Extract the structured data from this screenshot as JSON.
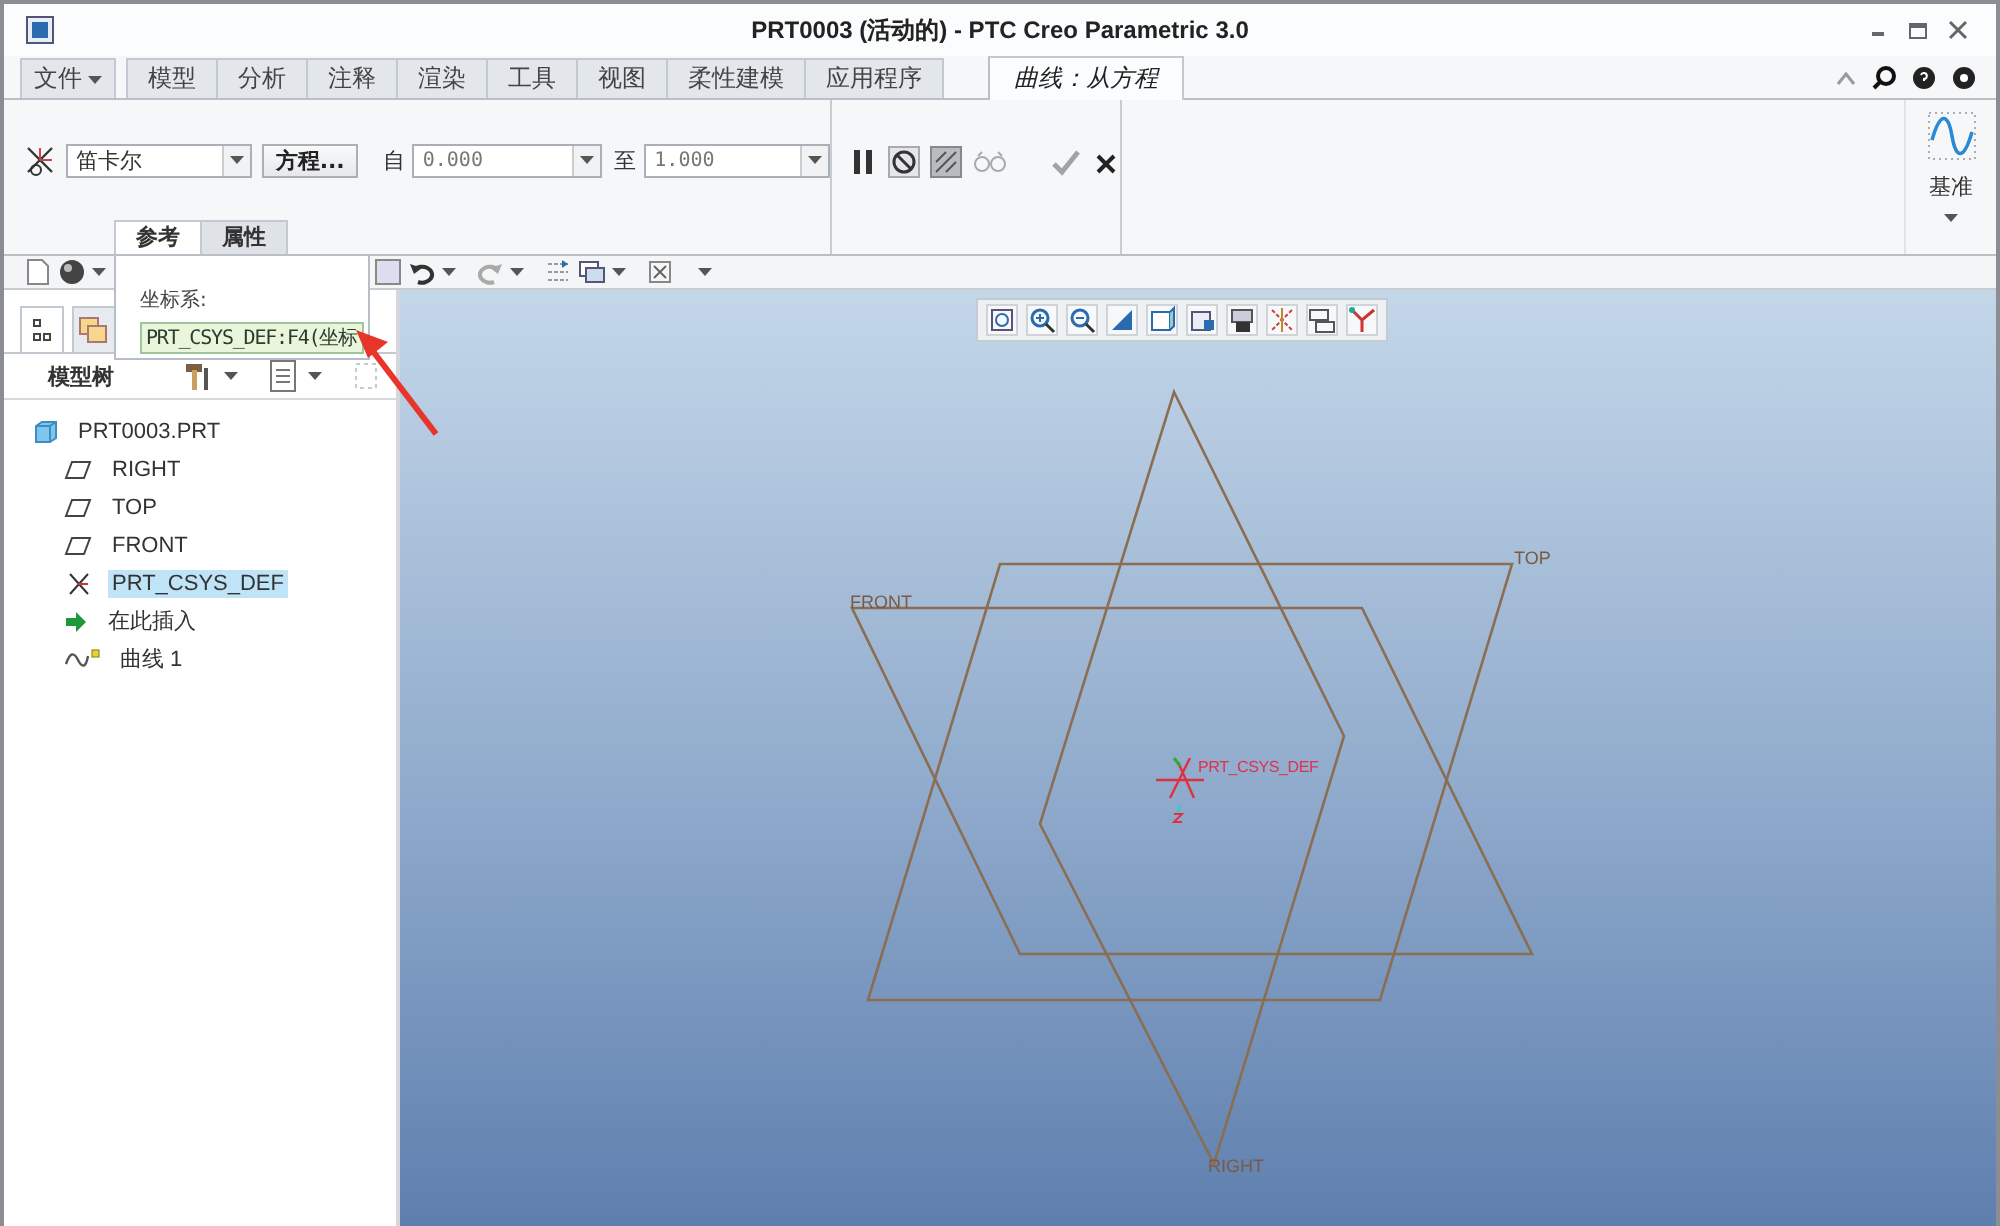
{
  "window": {
    "title": "PRT0003 (活动的) - PTC Creo Parametric 3.0"
  },
  "ribbon_tabs": [
    {
      "label": "文件",
      "kind": "menu",
      "selected": false
    },
    {
      "label": "模型",
      "kind": "tab",
      "selected": false
    },
    {
      "label": "分析",
      "kind": "tab",
      "selected": false
    },
    {
      "label": "注释",
      "kind": "tab",
      "selected": false
    },
    {
      "label": "渲染",
      "kind": "tab",
      "selected": false
    },
    {
      "label": "工具",
      "kind": "tab",
      "selected": false
    },
    {
      "label": "视图",
      "kind": "tab",
      "selected": false
    },
    {
      "label": "柔性建模",
      "kind": "tab",
      "selected": false
    },
    {
      "label": "应用程序",
      "kind": "tab",
      "selected": false
    },
    {
      "label": "曲线：从方程",
      "kind": "contextual",
      "selected": true
    }
  ],
  "dashboard": {
    "coordinate_type": "笛卡尔",
    "equation_button": "方程...",
    "from_label": "自",
    "from_value": "0.000",
    "to_label": "至",
    "to_value": "1.000",
    "datum_group": "基准"
  },
  "dashboard_tabs": [
    {
      "label": "参考",
      "selected": true
    },
    {
      "label": "属性",
      "selected": false
    }
  ],
  "references_panel": {
    "label": "坐标系:",
    "value": "PRT_CSYS_DEF:F4(坐标"
  },
  "model_tree": {
    "title": "模型树",
    "items": [
      {
        "label": "PRT0003.PRT",
        "kind": "part",
        "selected": false,
        "children": [
          {
            "label": "RIGHT",
            "kind": "plane",
            "selected": false
          },
          {
            "label": "TOP",
            "kind": "plane",
            "selected": false
          },
          {
            "label": "FRONT",
            "kind": "plane",
            "selected": false
          },
          {
            "label": "PRT_CSYS_DEF",
            "kind": "csys",
            "selected": true
          },
          {
            "label": "在此插入",
            "kind": "insert",
            "selected": false
          },
          {
            "label": "曲线 1",
            "kind": "curve",
            "selected": false
          }
        ]
      }
    ]
  },
  "graphics": {
    "planes": [
      {
        "label": "RIGHT"
      },
      {
        "label": "TOP"
      },
      {
        "label": "FRONT"
      }
    ],
    "csys_label": "PRT_CSYS_DEF"
  }
}
